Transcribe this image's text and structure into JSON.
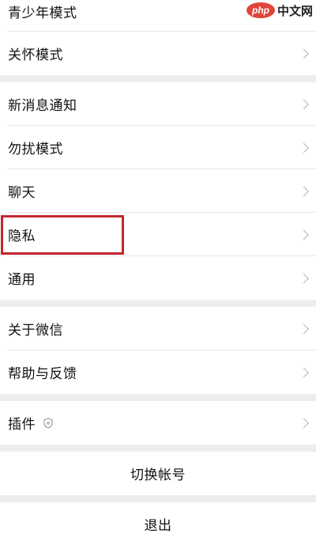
{
  "menu": {
    "top_partial": "青少年模式",
    "care_mode": "关怀模式",
    "new_message_notification": "新消息通知",
    "do_not_disturb": "勿扰模式",
    "chat": "聊天",
    "privacy": "隐私",
    "general": "通用",
    "about_wechat": "关于微信",
    "help_feedback": "帮助与反馈",
    "plugins": "插件"
  },
  "actions": {
    "switch_account": "切换帐号",
    "logout": "退出"
  },
  "watermark": {
    "logo": "php",
    "text": "中文网"
  },
  "colors": {
    "highlight_border": "#c0282e",
    "background": "#ededed",
    "row_bg": "#ffffff",
    "chevron": "#b3b3b3"
  }
}
